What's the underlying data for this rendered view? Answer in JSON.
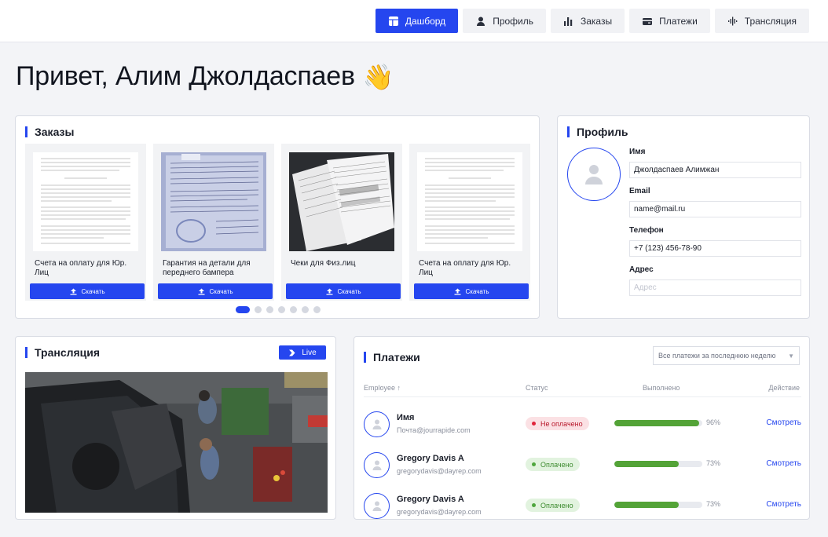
{
  "nav": [
    {
      "label": "Дашборд",
      "icon": "dashboard-icon",
      "active": true
    },
    {
      "label": "Профиль",
      "icon": "user-icon",
      "active": false
    },
    {
      "label": "Заказы",
      "icon": "bar-chart-icon",
      "active": false
    },
    {
      "label": "Платежи",
      "icon": "wallet-icon",
      "active": false
    },
    {
      "label": "Трансляция",
      "icon": "soundwave-icon",
      "active": false
    }
  ],
  "greeting": {
    "text": "Привет, Алим Джолдаспаев",
    "emoji": "👋"
  },
  "orders": {
    "title": "Заказы",
    "items": [
      {
        "name": "Счета на оплату для Юр. Лиц",
        "download": "Скачать"
      },
      {
        "name": "Гарантия на детали для переднего бампера",
        "download": "Скачать"
      },
      {
        "name": "Чеки для Физ.лиц",
        "download": "Скачать"
      },
      {
        "name": "Счета на оплату для Юр. Лиц",
        "download": "Скачать"
      }
    ],
    "pagination": {
      "total": 7,
      "active": 0
    }
  },
  "profile": {
    "title": "Профиль",
    "fields": [
      {
        "label": "Имя",
        "value": "Джолдаспаев Алимжан",
        "placeholder": ""
      },
      {
        "label": "Email",
        "value": "name@mail.ru",
        "placeholder": ""
      },
      {
        "label": "Телефон",
        "value": "+7 (123) 456-78-90",
        "placeholder": ""
      },
      {
        "label": "Адрес",
        "value": "",
        "placeholder": "Адрес"
      }
    ]
  },
  "broadcast": {
    "title": "Трансляция",
    "live_label": "Live"
  },
  "payments": {
    "title": "Платежи",
    "filter": "Все платежи за последнюю неделю",
    "columns": {
      "employee": "Employee ↑",
      "status": "Статус",
      "done": "Выполнено",
      "action": "Действие"
    },
    "rows": [
      {
        "name": "Имя",
        "email": "Почта@jourrapide.com",
        "status": "Не оплачено",
        "status_type": "unpaid",
        "progress": 96,
        "progress_label": "96%",
        "action": "Смотреть"
      },
      {
        "name": "Gregory Davis A",
        "email": "gregorydavis@dayrep.com",
        "status": "Оплачено",
        "status_type": "paid",
        "progress": 73,
        "progress_label": "73%",
        "action": "Смотреть"
      },
      {
        "name": "Gregory Davis A",
        "email": "gregorydavis@dayrep.com",
        "status": "Оплачено",
        "status_type": "paid",
        "progress": 73,
        "progress_label": "73%",
        "action": "Смотреть"
      }
    ]
  },
  "colors": {
    "accent": "#2546ef",
    "paid": "#4ea63d",
    "unpaid": "#e0243a"
  }
}
